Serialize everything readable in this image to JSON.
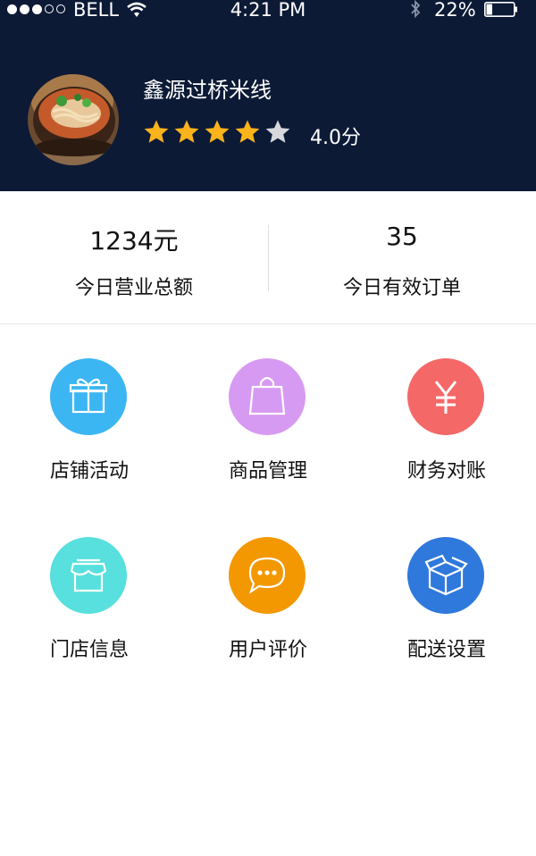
{
  "status_bar": {
    "carrier": "BELL",
    "time": "4:21 PM",
    "battery": "22%",
    "battery_level": 0.22
  },
  "shop": {
    "name": "鑫源过桥米线",
    "rating_value": 4.0,
    "rating_max": 5,
    "rating_text": "4.0分",
    "star_color": "#fbb31c",
    "star_empty_color": "#d6d8dc"
  },
  "stats": [
    {
      "value": "1234元",
      "label": "今日营业总额"
    },
    {
      "value": "35",
      "label": "今日有效订单"
    }
  ],
  "menu": [
    {
      "label": "店铺活动",
      "icon": "gift-icon",
      "color": "#3bb6f2"
    },
    {
      "label": "商品管理",
      "icon": "shopping-bag-icon",
      "color": "#d79af2"
    },
    {
      "label": "财务对账",
      "icon": "yen-icon",
      "color": "#f56868"
    },
    {
      "label": "门店信息",
      "icon": "storefront-icon",
      "color": "#57e0dd"
    },
    {
      "label": "用户评价",
      "icon": "chat-bubble-icon",
      "color": "#f39800"
    },
    {
      "label": "配送设置",
      "icon": "box-icon",
      "color": "#2f78dc"
    }
  ]
}
